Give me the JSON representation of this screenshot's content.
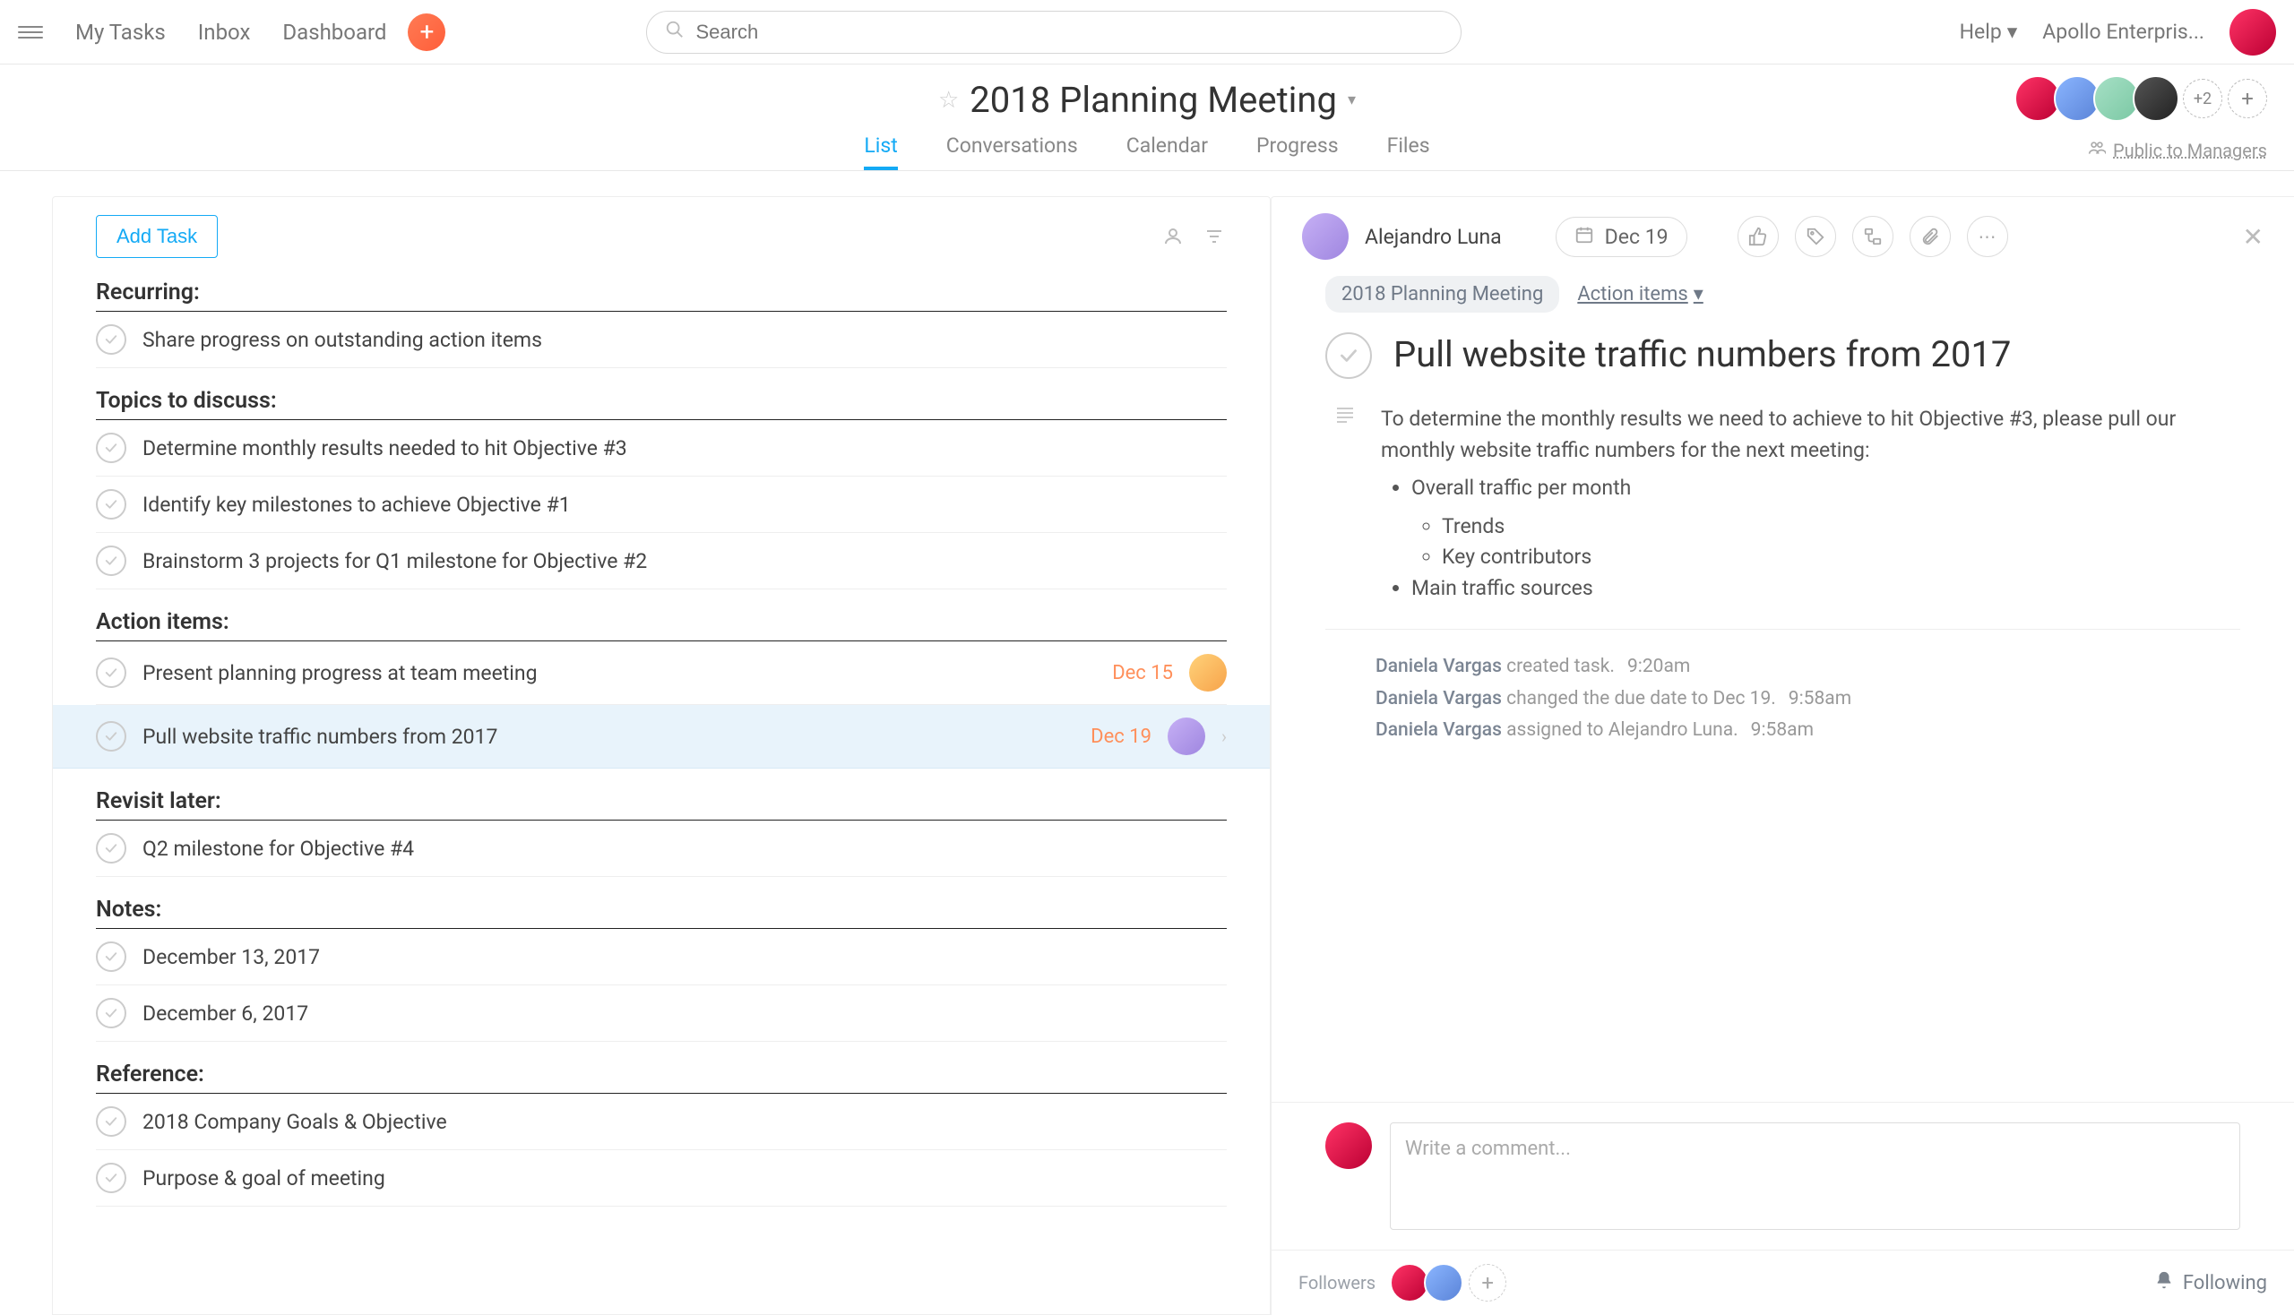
{
  "topbar": {
    "nav": {
      "my_tasks": "My Tasks",
      "inbox": "Inbox",
      "dashboard": "Dashboard"
    },
    "search_placeholder": "Search",
    "help": "Help",
    "org": "Apollo Enterpris..."
  },
  "project": {
    "title": "2018 Planning Meeting",
    "tabs": {
      "list": "List",
      "conversations": "Conversations",
      "calendar": "Calendar",
      "progress": "Progress",
      "files": "Files"
    },
    "collaborators_more": "+2",
    "privacy": "Public to Managers"
  },
  "list": {
    "add_task": "Add Task",
    "sections": [
      {
        "title": "Recurring:",
        "tasks": [
          {
            "title": "Share progress on outstanding action items"
          }
        ]
      },
      {
        "title": "Topics to discuss:",
        "tasks": [
          {
            "title": "Determine monthly results needed to hit Objective #3"
          },
          {
            "title": "Identify key milestones to achieve Objective #1"
          },
          {
            "title": "Brainstorm 3 projects for Q1 milestone for Objective #2"
          }
        ]
      },
      {
        "title": "Action items:",
        "tasks": [
          {
            "title": "Present planning progress at team meeting",
            "date": "Dec 15",
            "avatar": "av5"
          },
          {
            "title": "Pull website traffic numbers from 2017",
            "date": "Dec 19",
            "avatar": "av6",
            "selected": true
          }
        ]
      },
      {
        "title": "Revisit later:",
        "tasks": [
          {
            "title": "Q2 milestone for Objective #4"
          }
        ]
      },
      {
        "title": "Notes:",
        "tasks": [
          {
            "title": "December 13, 2017"
          },
          {
            "title": "December 6, 2017"
          }
        ]
      },
      {
        "title": "Reference:",
        "tasks": [
          {
            "title": "2018 Company Goals & Objective"
          },
          {
            "title": "Purpose & goal of meeting"
          }
        ]
      }
    ]
  },
  "detail": {
    "assignee": "Alejandro Luna",
    "date": "Dec 19",
    "project_pill": "2018 Planning Meeting",
    "section_link": "Action items",
    "title": "Pull website traffic numbers from 2017",
    "description_intro": "To determine the monthly results we need to achieve to hit Objective #3, please pull our monthly website traffic numbers for the next meeting:",
    "bullets": {
      "b1": "Overall traffic per month",
      "b1a": "Trends",
      "b1b": "Key contributors",
      "b2": "Main traffic sources"
    },
    "activity": [
      {
        "actor": "Daniela Vargas",
        "action": "created task.",
        "time": "9:20am"
      },
      {
        "actor": "Daniela Vargas",
        "action": "changed the due date to Dec 19.",
        "time": "9:58am"
      },
      {
        "actor": "Daniela Vargas",
        "action": "assigned to Alejandro Luna.",
        "time": "9:58am"
      }
    ],
    "comment_placeholder": "Write a comment...",
    "followers_label": "Followers",
    "following": "Following"
  }
}
